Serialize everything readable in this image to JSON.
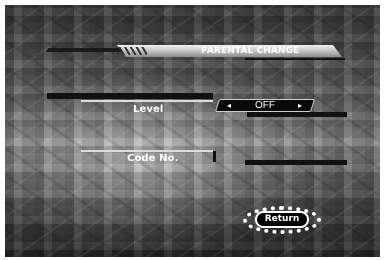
{
  "screen": {
    "title": "PARENTAL CHANGE"
  },
  "level": {
    "label": "Level",
    "value": "OFF",
    "left_arrow": "◂",
    "right_arrow": "▸"
  },
  "code": {
    "label": "Code No."
  },
  "buttons": {
    "return_label": "Return"
  }
}
